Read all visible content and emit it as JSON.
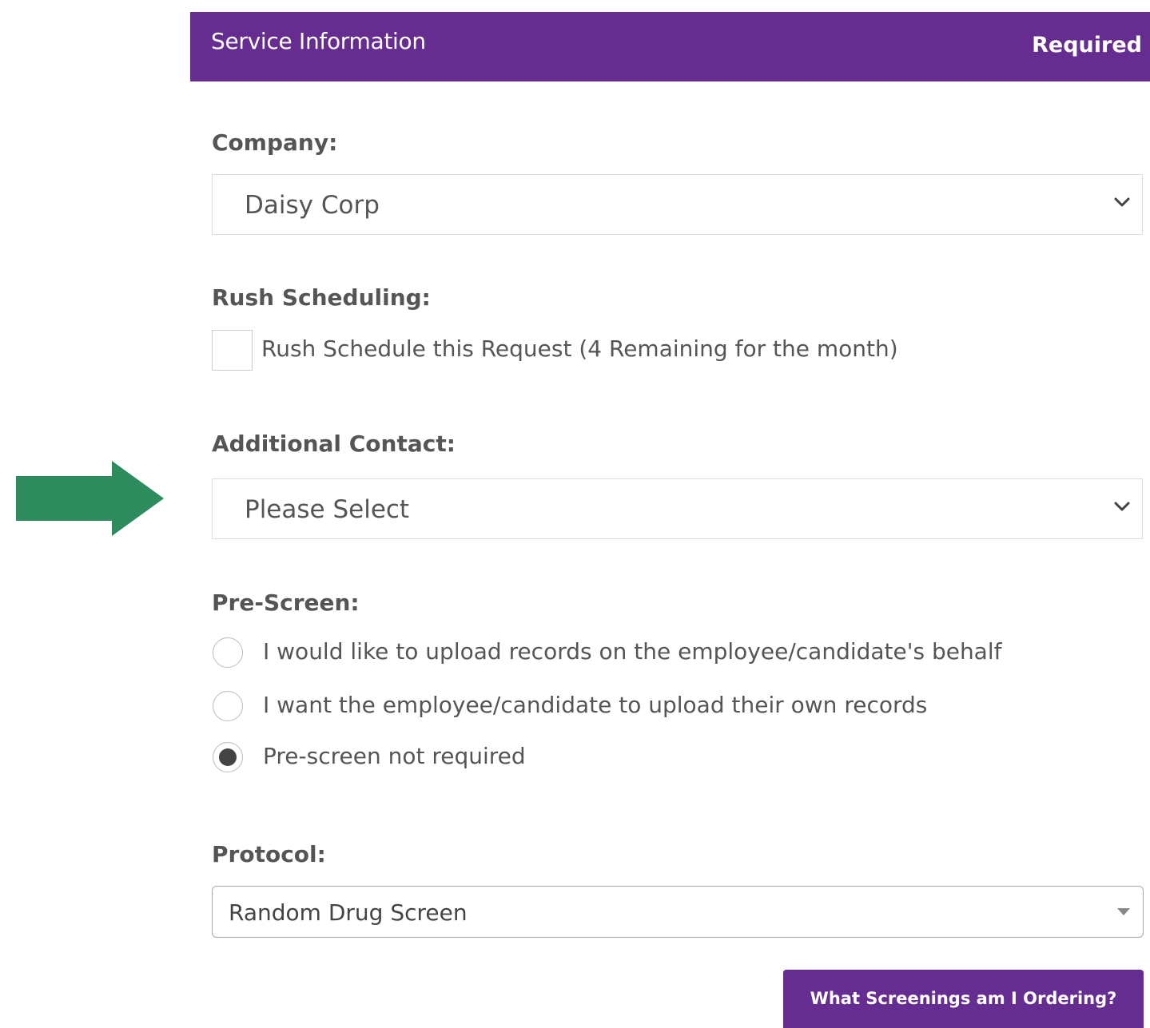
{
  "colors": {
    "brand_purple": "#662d91",
    "annotation_arrow": "#2e8b5e"
  },
  "header": {
    "title": "Service Information",
    "required_label": "Required"
  },
  "company": {
    "label": "Company:",
    "selected_value": "Daisy Corp"
  },
  "rush": {
    "label": "Rush Scheduling:",
    "checkbox_label": "Rush Schedule this Request (4 Remaining for the month)",
    "checked": false
  },
  "additional_contact": {
    "label": "Additional Contact:",
    "selected_value": "Please Select"
  },
  "prescreen": {
    "label": "Pre-Screen:",
    "options": [
      {
        "label": "I would like to upload records on the employee/candidate's behalf",
        "checked": false
      },
      {
        "label": "I want the employee/candidate to upload their own records",
        "checked": false
      },
      {
        "label": "Pre-screen not required",
        "checked": true
      }
    ]
  },
  "protocol": {
    "label": "Protocol:",
    "selected_value": "Random Drug Screen"
  },
  "actions": {
    "screenings_button": "What Screenings am I Ordering?"
  },
  "annotation": {
    "icon": "right-arrow-icon"
  }
}
